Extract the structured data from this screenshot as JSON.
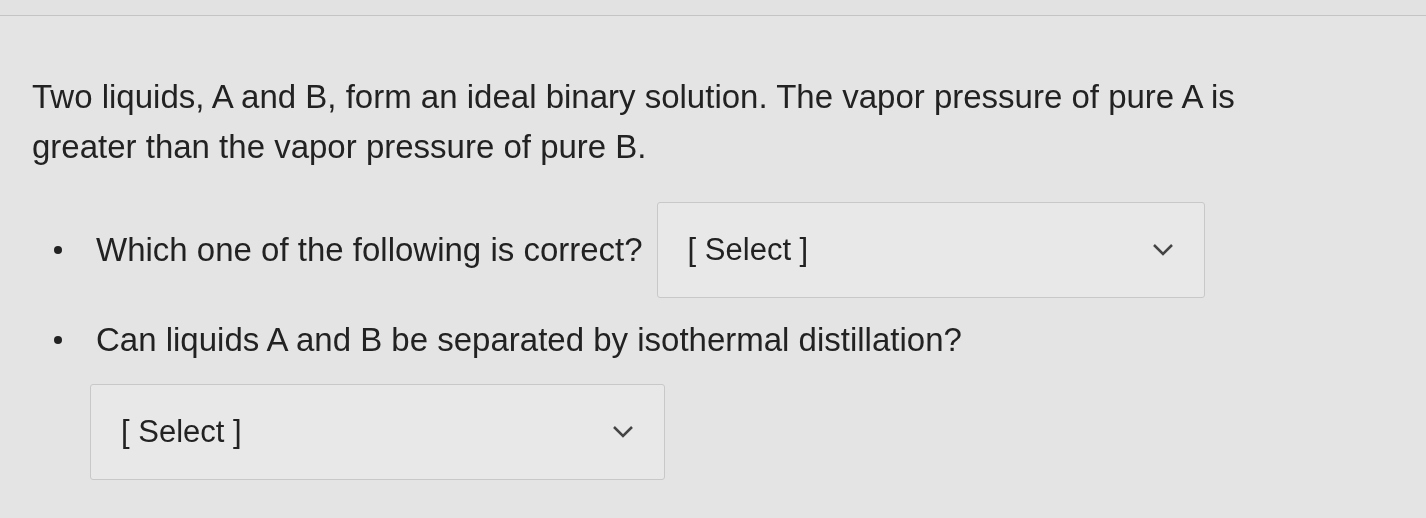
{
  "question": {
    "text": "Two liquids, A and B, form an ideal binary solution.  The vapor pressure of pure A is greater than the vapor pressure of pure B.",
    "items": [
      {
        "kind": "inline",
        "prompt": "Which one of the following is correct?",
        "select": {
          "value": "[ Select ]"
        }
      },
      {
        "kind": "below",
        "prompt": "Can liquids A and B be separated by isothermal distillation?",
        "select": {
          "value": "[ Select ]"
        }
      }
    ]
  }
}
